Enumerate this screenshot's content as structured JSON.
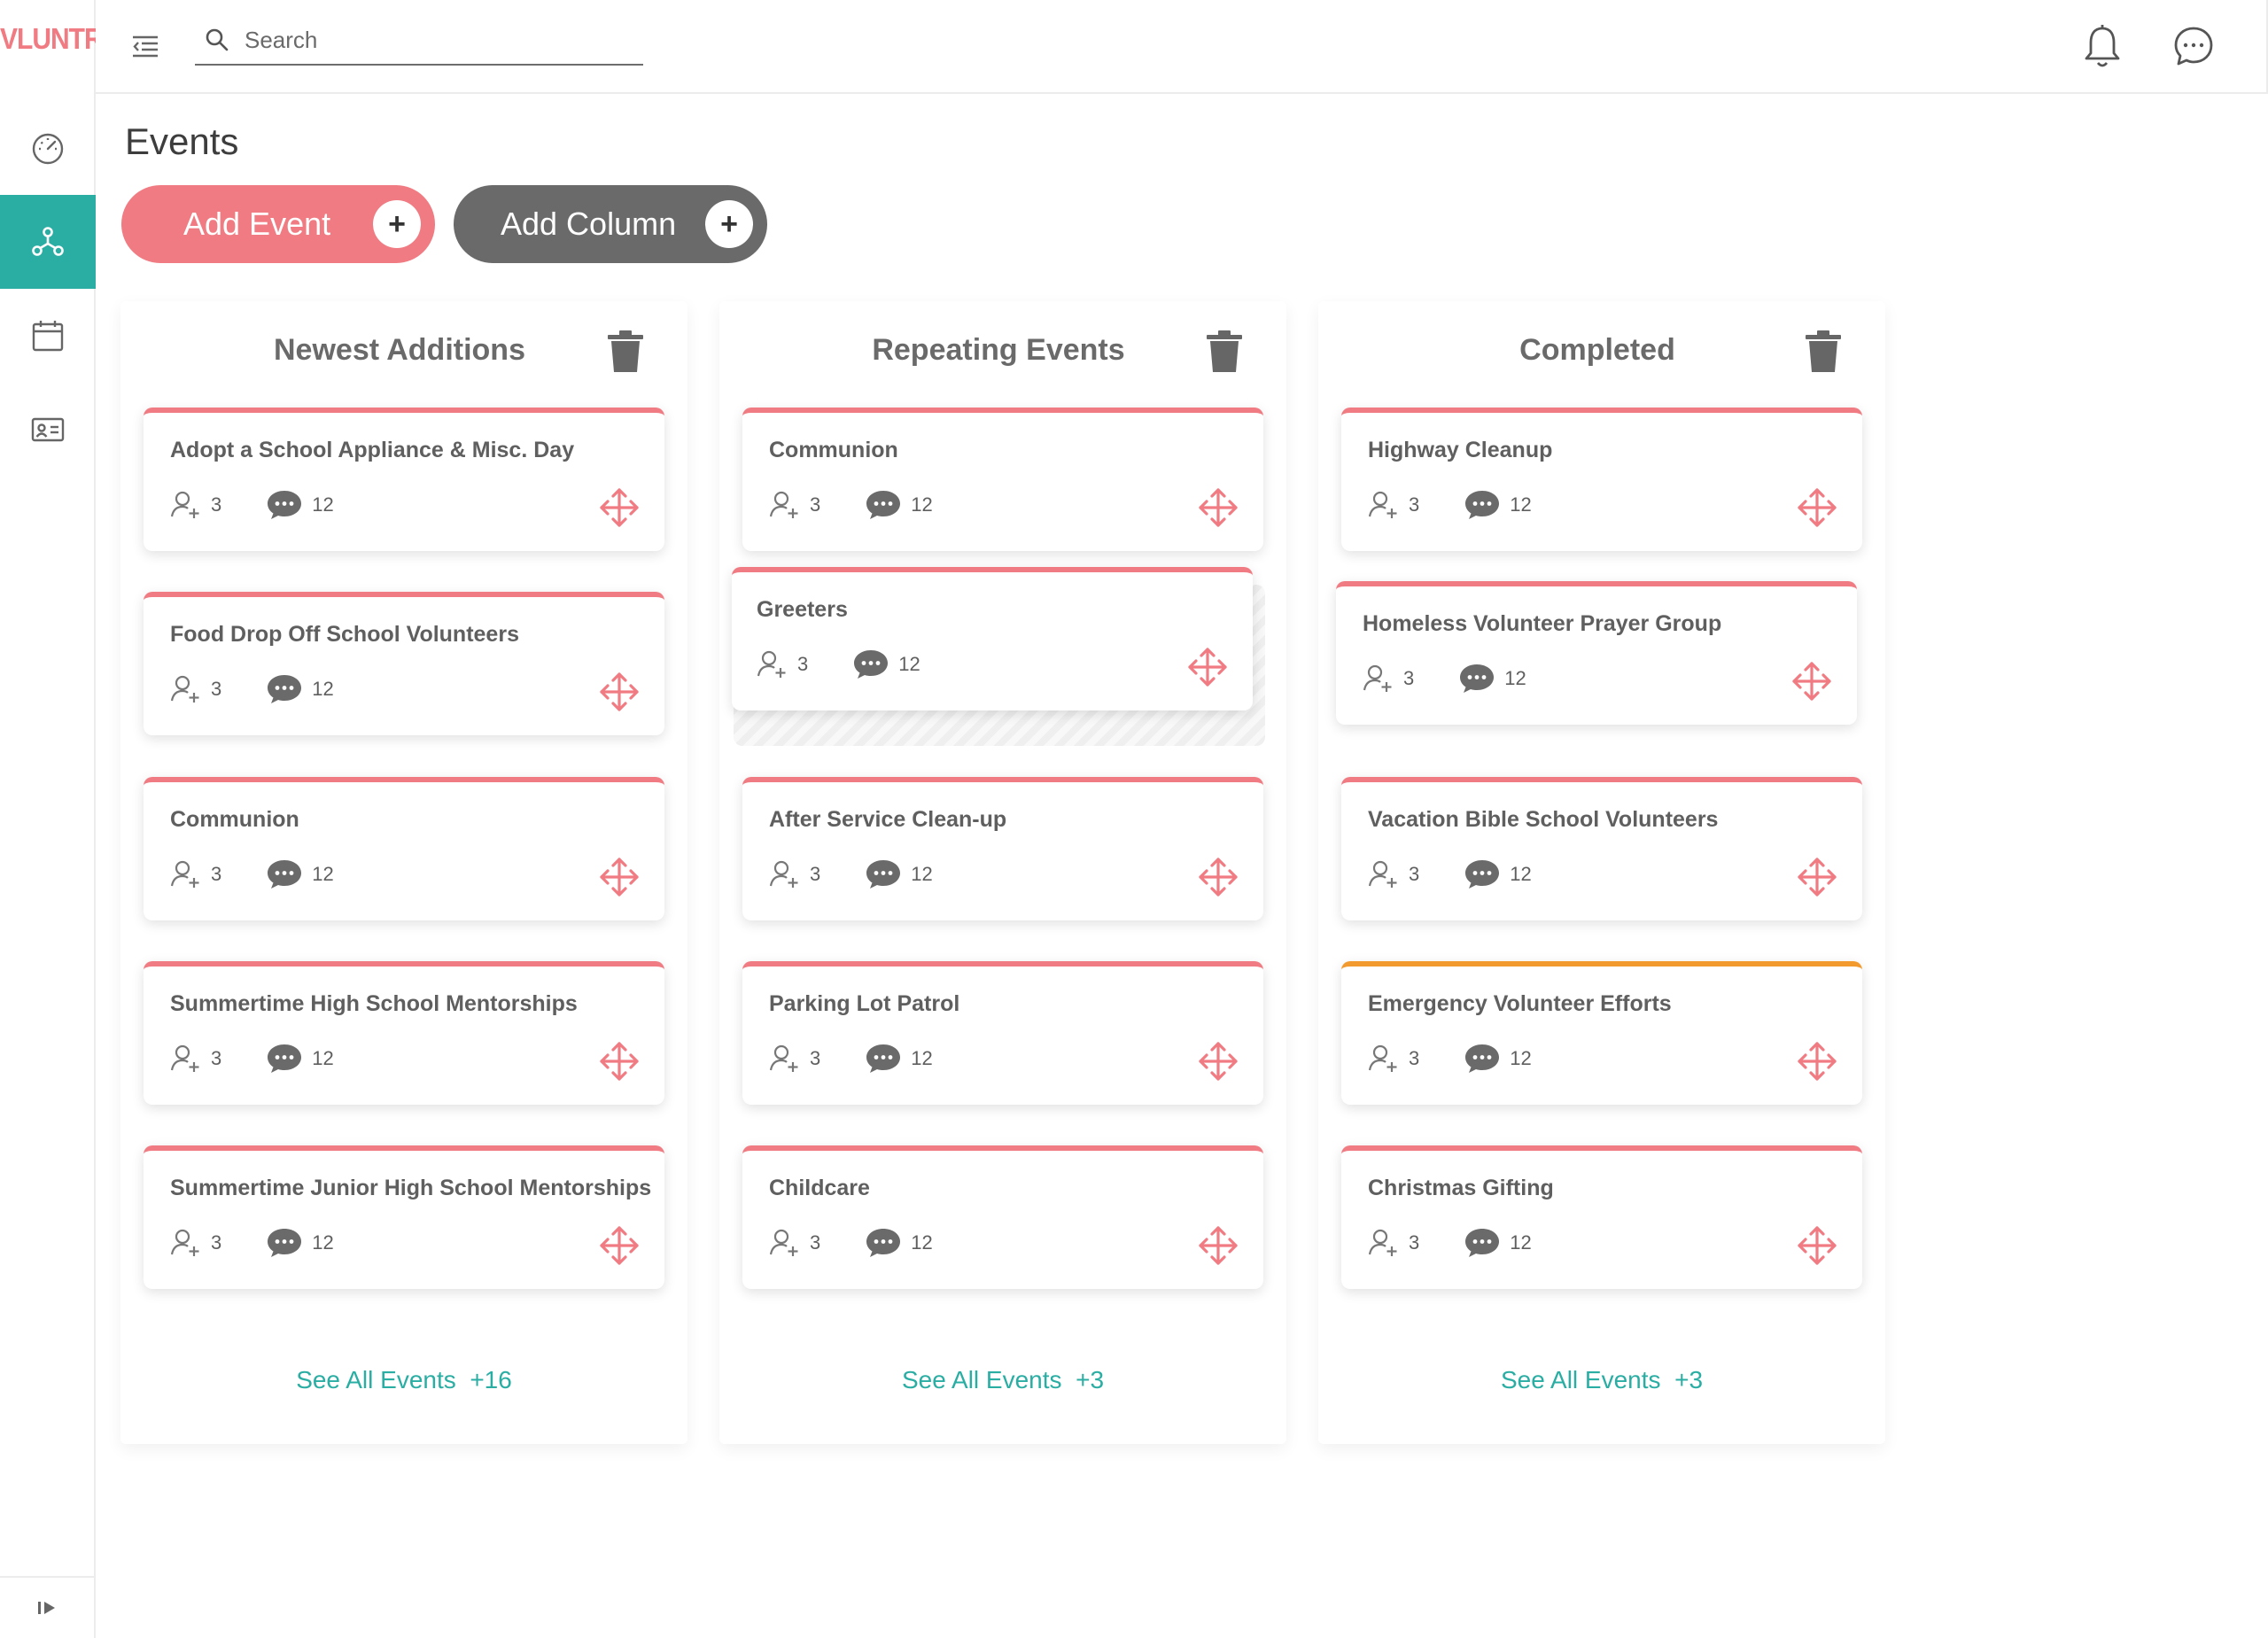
{
  "app": {
    "logo": "VLUNTR"
  },
  "sidebar": {
    "items": [
      {
        "name": "dashboard",
        "icon": "gauge-icon",
        "active": false
      },
      {
        "name": "network",
        "icon": "network-icon",
        "active": true
      },
      {
        "name": "calendar",
        "icon": "calendar-icon",
        "active": false
      },
      {
        "name": "contacts",
        "icon": "id-card-icon",
        "active": false
      }
    ],
    "collapse_icon": "expand-sidebar-icon"
  },
  "topbar": {
    "search_placeholder": "Search",
    "notifications_icon": "bell-icon",
    "messages_icon": "chat-bubble-icon"
  },
  "page": {
    "title": "Events",
    "add_event_label": "Add Event",
    "add_column_label": "Add Column",
    "plus_glyph": "+"
  },
  "colors": {
    "accent": "#f07b82",
    "teal": "#2aada3",
    "dark_pill": "#6a6a6a",
    "warning": "#f39a2f"
  },
  "columns": [
    {
      "title": "Newest Additions",
      "see_all_label": "See All Events",
      "see_all_count": "+16",
      "cards": [
        {
          "title": "Adopt a School Appliance & Misc. Day",
          "volunteers": "3",
          "comments": "12"
        },
        {
          "title": "Food Drop Off School Volunteers",
          "volunteers": "3",
          "comments": "12"
        },
        {
          "title": "Communion",
          "volunteers": "3",
          "comments": "12"
        },
        {
          "title": "Summertime High School Mentorships",
          "volunteers": "3",
          "comments": "12"
        },
        {
          "title": "Summertime Junior High School Mentorships",
          "volunteers": "3",
          "comments": "12"
        }
      ]
    },
    {
      "title": "Repeating Events",
      "see_all_label": "See All Events",
      "see_all_count": "+3",
      "cards": [
        {
          "title": "Communion",
          "volunteers": "3",
          "comments": "12"
        },
        {
          "title": "Greeters",
          "volunteers": "3",
          "comments": "12",
          "dragging": true
        },
        {
          "title": "After Service Clean-up",
          "volunteers": "3",
          "comments": "12"
        },
        {
          "title": "Parking Lot Patrol",
          "volunteers": "3",
          "comments": "12"
        },
        {
          "title": "Childcare",
          "volunteers": "3",
          "comments": "12"
        }
      ]
    },
    {
      "title": "Completed",
      "see_all_label": "See All Events",
      "see_all_count": "+3",
      "cards": [
        {
          "title": "Highway Cleanup",
          "volunteers": "3",
          "comments": "12"
        },
        {
          "title": "Homeless Volunteer Prayer Group",
          "volunteers": "3",
          "comments": "12"
        },
        {
          "title": "Vacation Bible School Volunteers",
          "volunteers": "3",
          "comments": "12"
        },
        {
          "title": "Emergency Volunteer Efforts",
          "volunteers": "3",
          "comments": "12",
          "status_color": "#f39a2f"
        },
        {
          "title": "Christmas Gifting",
          "volunteers": "3",
          "comments": "12"
        }
      ]
    }
  ]
}
